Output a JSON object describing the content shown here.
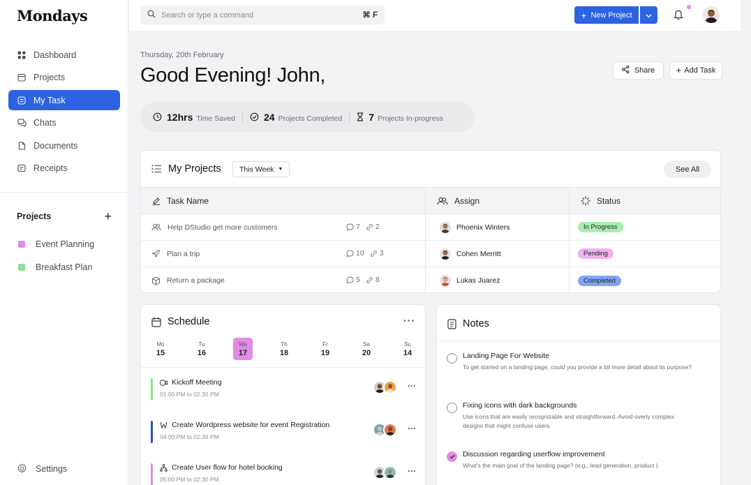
{
  "app": {
    "name": "Mondays"
  },
  "sidebar": {
    "nav": [
      {
        "label": "Dashboard",
        "icon": "dashboard-icon"
      },
      {
        "label": "Projects",
        "icon": "folder-icon"
      },
      {
        "label": "My Task",
        "icon": "task-icon",
        "active": true
      },
      {
        "label": "Chats",
        "icon": "chat-icon"
      },
      {
        "label": "Documents",
        "icon": "document-icon"
      },
      {
        "label": "Receipts",
        "icon": "receipt-icon"
      }
    ],
    "projects_heading": "Projects",
    "projects_add": "+",
    "projects": [
      {
        "label": "Event Planning",
        "color": "#e08be6"
      },
      {
        "label": "Breakfast Plan",
        "color": "#8be08f"
      }
    ],
    "settings_label": "Settings"
  },
  "topbar": {
    "search_placeholder": "Search or type a command",
    "search_shortcut": "⌘ F",
    "new_project_label": "New Project",
    "accent": "#2d63e0"
  },
  "header": {
    "date": "Thursday, 20th February",
    "greeting": "Good Evening! John,",
    "share_label": "Share",
    "add_task_label": "Add Task"
  },
  "stats": [
    {
      "value": "12hrs",
      "label": "Time Saved",
      "icon": "clock-icon"
    },
    {
      "value": "24",
      "label": "Projects Completed",
      "icon": "check-circle-icon"
    },
    {
      "value": "7",
      "label": "Projects In-progress",
      "icon": "hourglass-icon"
    }
  ],
  "my_projects": {
    "title": "My Projects",
    "filter": "This Week",
    "see_all": "See All",
    "columns": [
      "Task Name",
      "Assign",
      "Status"
    ],
    "rows": [
      {
        "task": "Help DStudio get more customers",
        "comments": "7",
        "links": "2",
        "assignee": "Phoenix Winters",
        "status": "In Progress",
        "status_color": "#a9ecb0",
        "task_icon": "users-icon"
      },
      {
        "task": "Plan a trip",
        "comments": "10",
        "links": "3",
        "assignee": "Cohen Merritt",
        "status": "Pending",
        "status_color": "#ecb1ee",
        "task_icon": "plane-icon"
      },
      {
        "task": "Return a package",
        "comments": "5",
        "links": "8",
        "assignee": "Lukas Juarez",
        "status": "Completed",
        "status_color": "#7ea6f4",
        "task_icon": "package-icon"
      }
    ]
  },
  "schedule": {
    "title": "Schedule",
    "more": "···",
    "days": [
      {
        "name": "Mo",
        "date": "15"
      },
      {
        "name": "Tu",
        "date": "16"
      },
      {
        "name": "We",
        "date": "17",
        "active": true
      },
      {
        "name": "Th",
        "date": "18"
      },
      {
        "name": "Fr",
        "date": "19"
      },
      {
        "name": "Sa",
        "date": "20"
      },
      {
        "name": "Su",
        "date": "14"
      }
    ],
    "events": [
      {
        "title": "Kickoff Meeting",
        "time": "01:00 PM to 02:30 PM",
        "color": "#8be08f",
        "icon": "video-icon"
      },
      {
        "title": "Create Wordpress website for event Registration",
        "time": "04:00 PM to 02:30 PM",
        "color": "#2d4fbf",
        "icon": "wordpress-icon"
      },
      {
        "title": "Create User flow for hotel booking",
        "time": "05:00 PM to 02:30 PM",
        "color": "#e08be6",
        "icon": "flow-icon"
      }
    ],
    "event_more": "···"
  },
  "notes": {
    "title": "Notes",
    "items": [
      {
        "title": "Landing Page For Website",
        "desc": "To get started on a landing page, could you provide a bit more detail about its purpose?",
        "checked": false
      },
      {
        "title": "Fixing icons with dark backgrounds",
        "desc": "Use icons that are easily recognizable and straightforward. Avoid overly complex designs that might confuse users",
        "checked": false
      },
      {
        "title": "Discussion regarding userflow improvement",
        "desc": "What's the main goal of the landing page? (e.g., lead generation, product )",
        "checked": true
      }
    ]
  }
}
